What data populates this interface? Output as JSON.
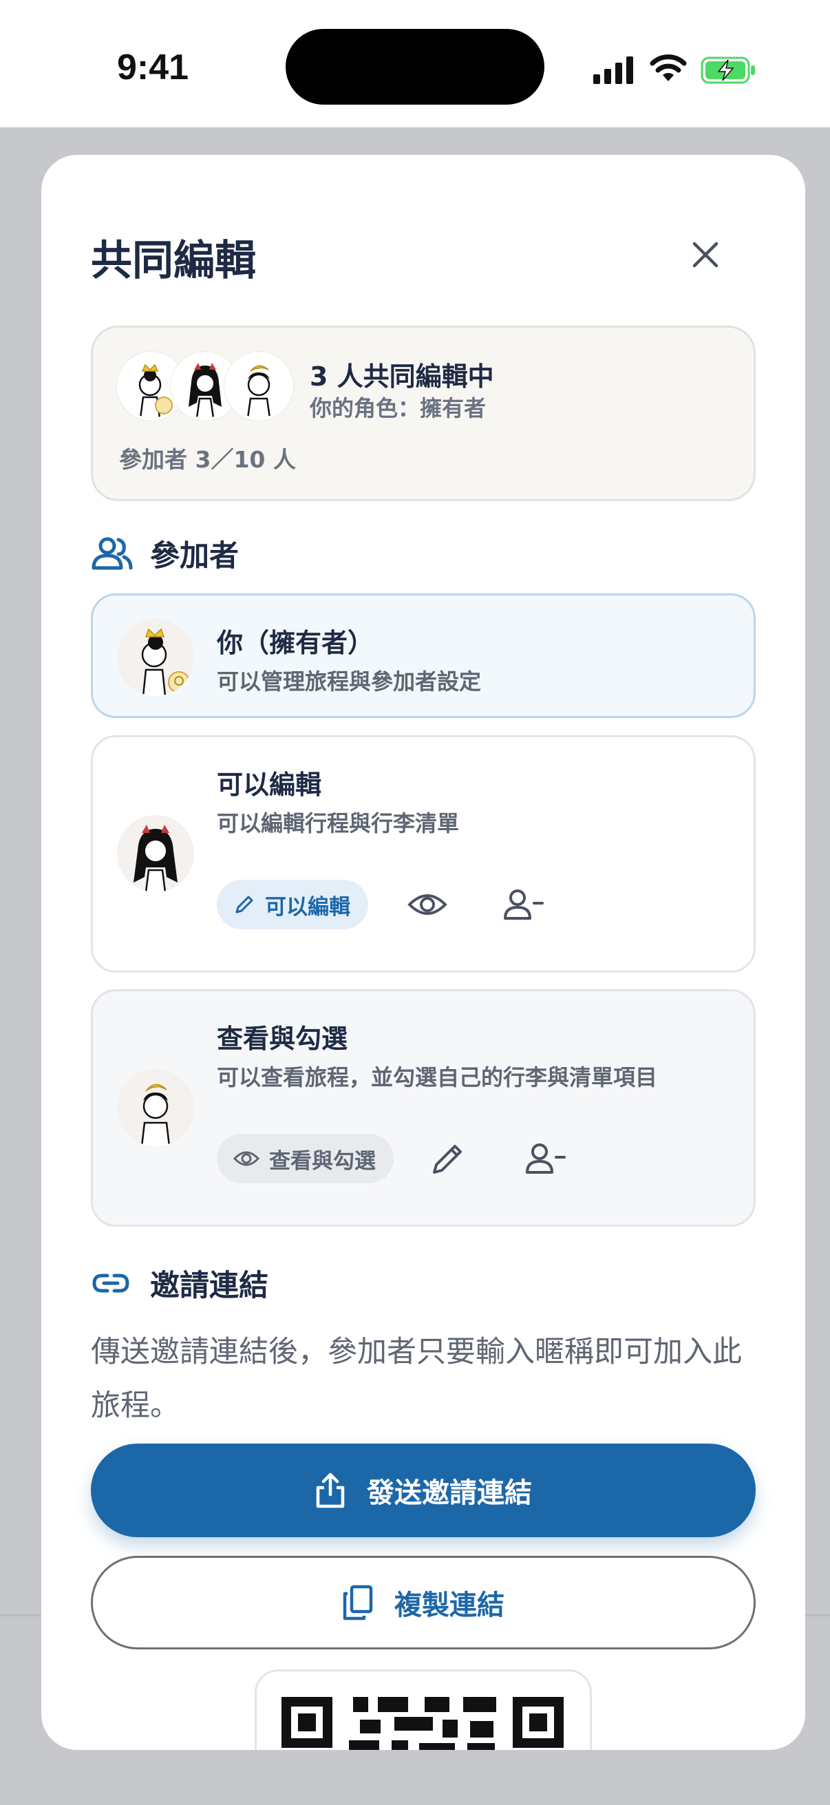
{
  "status_bar": {
    "time": "9:41"
  },
  "sheet": {
    "title": "共同編輯",
    "summary": {
      "title": "3 人共同編輯中",
      "role": "你的角色：擁有者",
      "count": "參加者 3／10 人"
    },
    "participants_section": {
      "label": "參加者"
    },
    "participants": [
      {
        "name": "你（擁有者）",
        "description": "可以管理旅程與參加者設定"
      },
      {
        "name": "可以編輯",
        "description": "可以編輯行程與行李清單",
        "role_pill": "可以編輯"
      },
      {
        "name": "查看與勾選",
        "description": "可以查看旅程，並勾選自己的行李與清單項目",
        "role_pill": "查看與勾選"
      }
    ],
    "invite_section": {
      "label": "邀請連結",
      "description": "傳送邀請連結後，參加者只要輸入暱稱即可加入此旅程。",
      "send_button": "發送邀請連結",
      "copy_button": "複製連結"
    }
  },
  "colors": {
    "accent": "#1c67a8",
    "title_text": "#1f2a44",
    "muted_text": "#5f6673",
    "owner_card_bg": "#f3f8fc",
    "battery_green": "#4cd964"
  },
  "icons": [
    "close-icon",
    "users-icon",
    "crown-badge-icon",
    "pencil-icon",
    "eye-icon",
    "remove-user-icon",
    "link-icon",
    "share-icon",
    "copy-icon",
    "signal-icon",
    "wifi-icon",
    "battery-icon"
  ]
}
